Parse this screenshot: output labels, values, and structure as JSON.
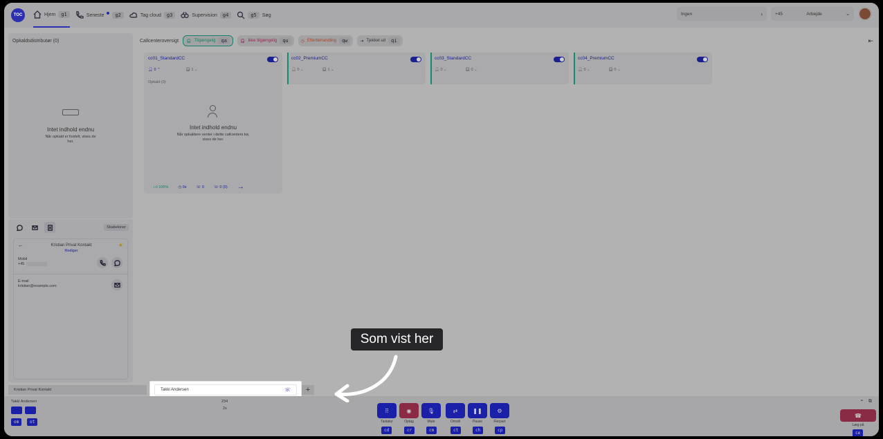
{
  "topbar": {
    "logo": "TOC",
    "nav": [
      {
        "label": "Hjem",
        "key": "g1"
      },
      {
        "label": "Seneste",
        "key": "g2"
      },
      {
        "label": "Tag cloud",
        "key": "g3"
      },
      {
        "label": "Supervision",
        "key": "g4"
      },
      {
        "label": "Søg",
        "key": "g5"
      }
    ],
    "status_select": "Ingen",
    "phone_prefix": "+45",
    "work_status": "Arbejde"
  },
  "left": {
    "title": "Opkaldsdistributør (0)",
    "empty_title": "Intet indhold endnu",
    "empty_text": "Når opkald er fordelt, vises de her."
  },
  "overview": {
    "label": "Callcenteroversigt",
    "filters": [
      {
        "label": "Tilgængelig",
        "key": "qa"
      },
      {
        "label": "Ikke tilgængelig",
        "key": "qu"
      },
      {
        "label": "Efterbehandling",
        "key": "qw"
      },
      {
        "label": "Tjekket ud",
        "key": "qi"
      }
    ]
  },
  "cards": [
    {
      "name": "cc01_StandardCC",
      "agents": "0",
      "queue": "1"
    },
    {
      "name": "cc02_PremiumCC",
      "agents": "0",
      "queue": "1"
    },
    {
      "name": "cc03_StandardCC",
      "agents": "0",
      "queue": "0"
    },
    {
      "name": "cc04_PremiumCC",
      "agents": "0",
      "queue": "0"
    }
  ],
  "card1": {
    "calls": "Opkald (0)",
    "empty_title": "Intet indhold endnu",
    "empty_text": "Når opkaldere venter i dette callcenters kø, vises de her.",
    "stats": [
      "100%",
      "0s",
      "0",
      "0 (0)"
    ]
  },
  "contact": {
    "templates": "Skabeloner",
    "name": "Kristian Privat Kontakt",
    "edit": "Rediger",
    "mobile_label": "Mobil",
    "mobile_value": "+45",
    "email_label": "E-mail",
    "email_value": "kristian@example.com"
  },
  "bottom": {
    "contact_tab": "Kristian Privat Kontakt",
    "call_tab": "Takki Andersen",
    "caller": "Takki Andersen",
    "number": "234",
    "duration": "2s",
    "left_keys": [
      "om",
      "ot"
    ],
    "controls": [
      {
        "label": "Tastatur",
        "key": "cd"
      },
      {
        "label": "Optag",
        "key": "cr"
      },
      {
        "label": "Mute",
        "key": "cm"
      },
      {
        "label": "Omstil",
        "key": "ct"
      },
      {
        "label": "Pause",
        "key": "ch"
      },
      {
        "label": "Flerpart",
        "key": "cp"
      }
    ],
    "hangup": "Læg på",
    "hangup_key": "ce"
  },
  "tooltip": "Som vist her"
}
